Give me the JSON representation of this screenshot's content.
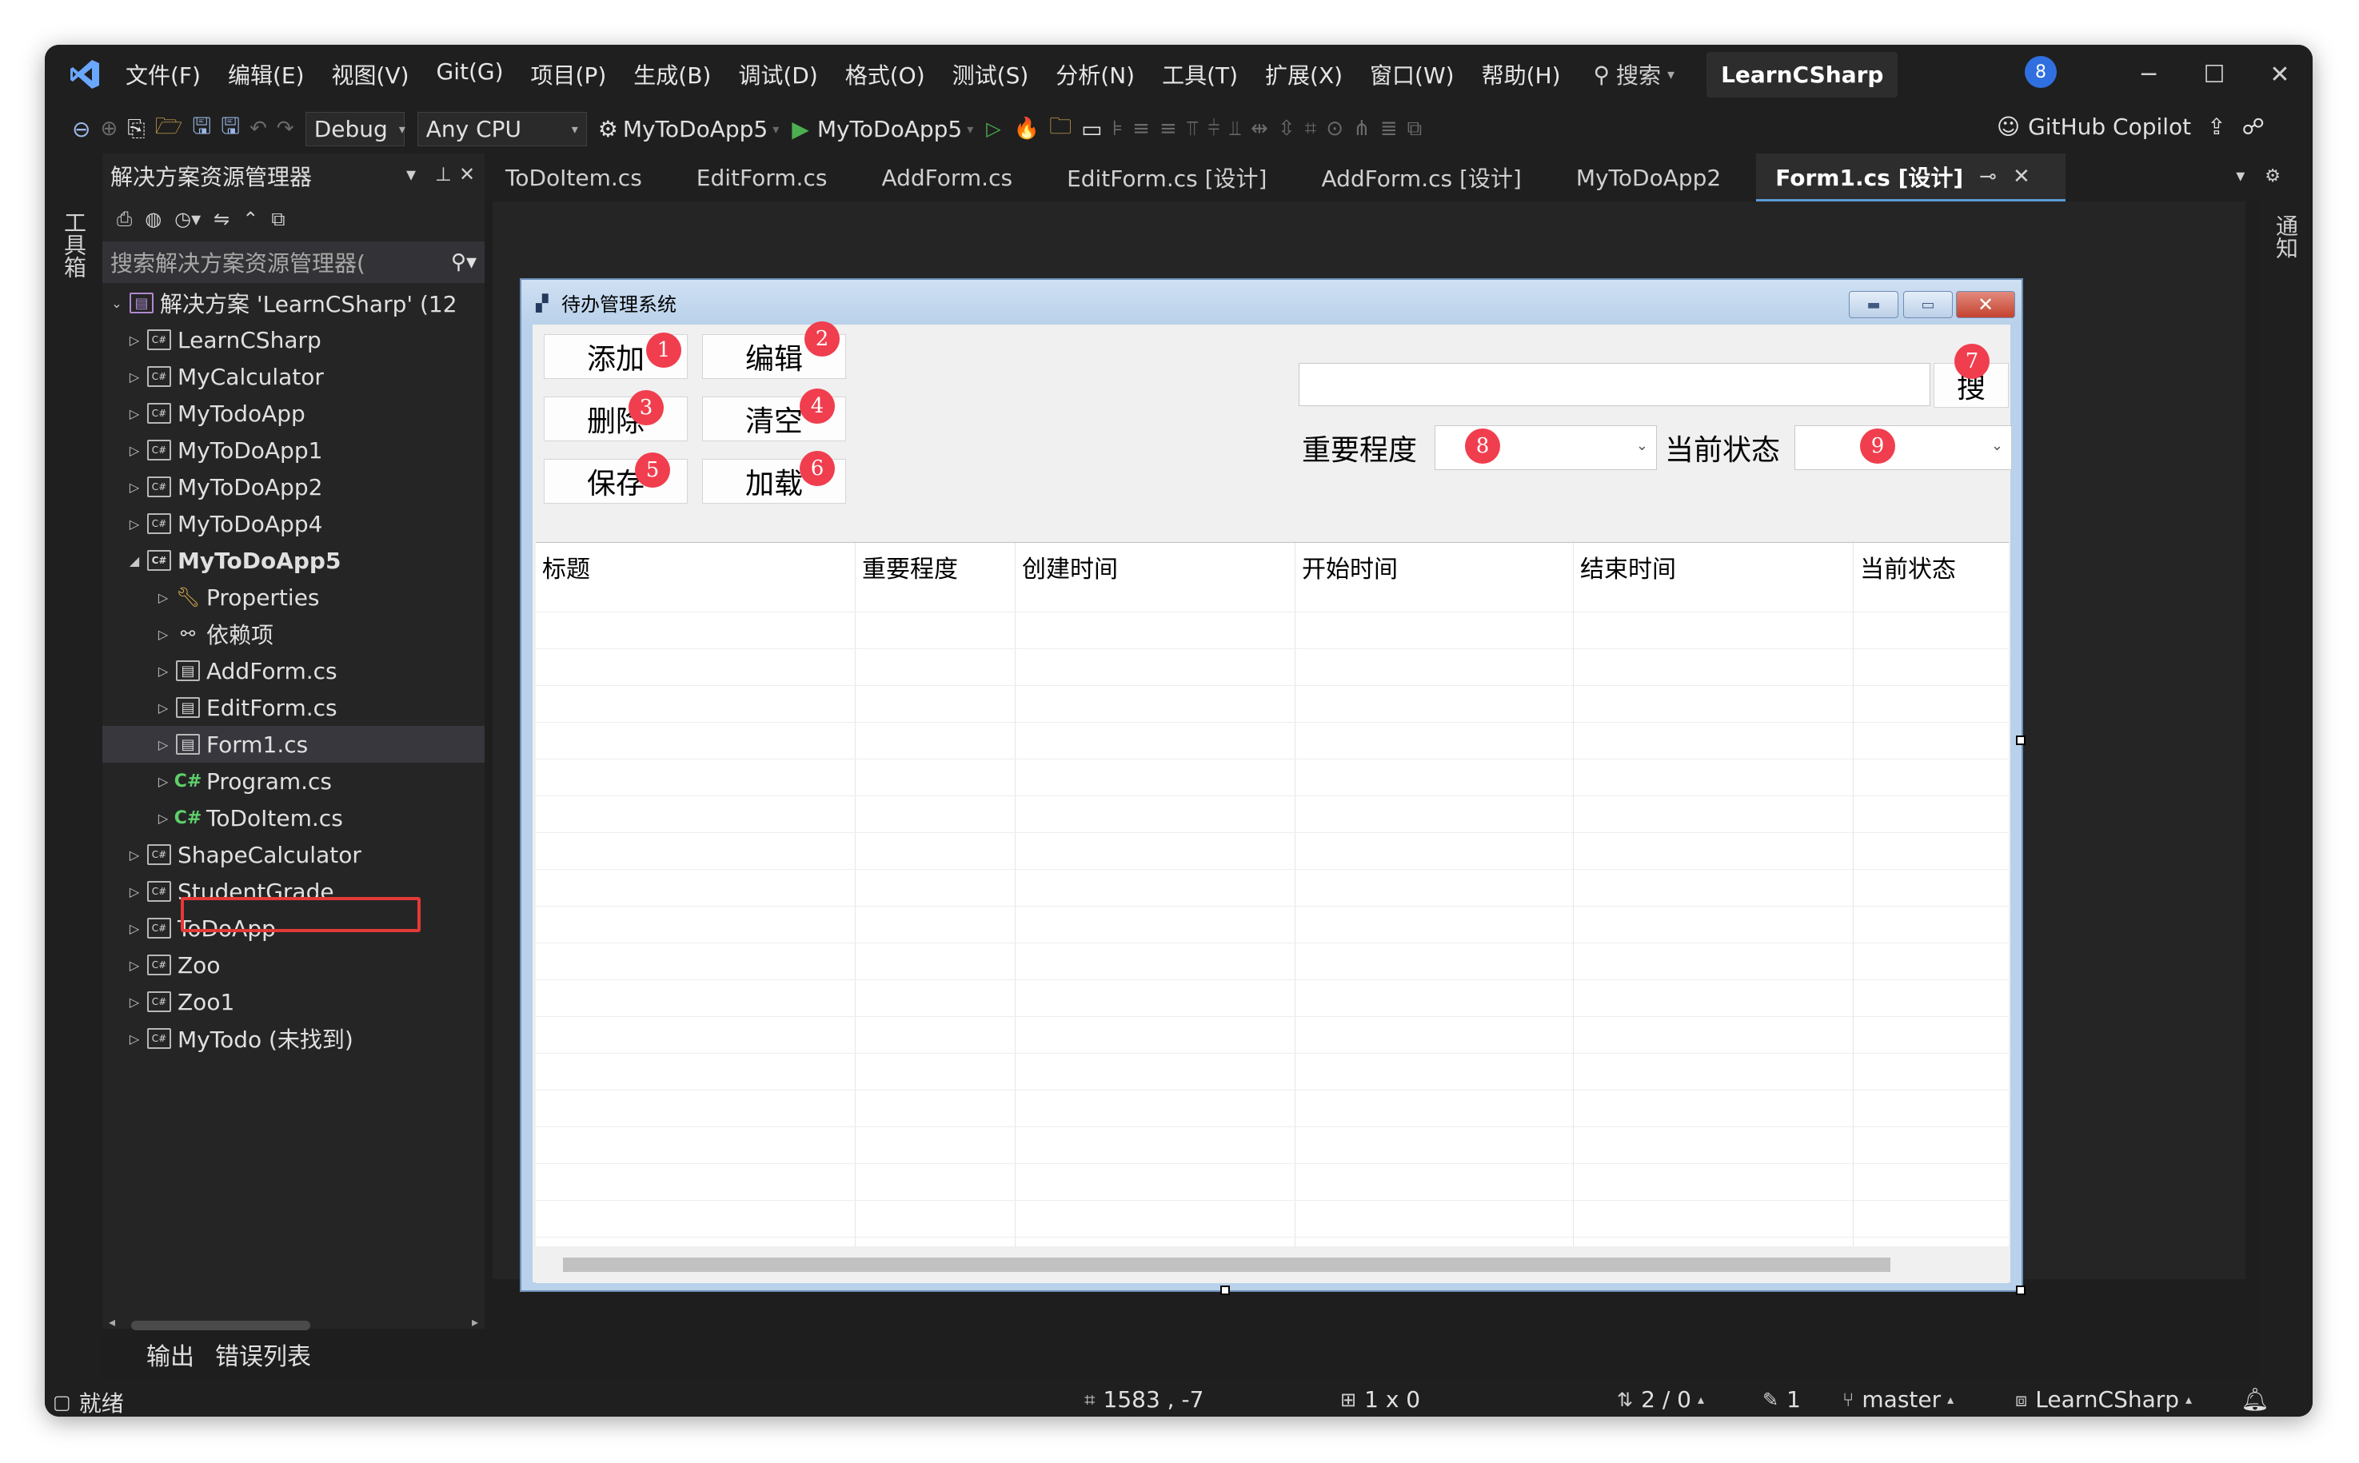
{
  "app": {
    "menu": [
      "文件(F)",
      "编辑(E)",
      "视图(V)",
      "Git(G)",
      "项目(P)",
      "生成(B)",
      "调试(D)",
      "格式(O)",
      "测试(S)",
      "分析(N)",
      "工具(T)",
      "扩展(X)",
      "窗口(W)",
      "帮助(H)"
    ],
    "search_label": "搜索",
    "solution_name": "LearnCSharp",
    "notification_badge": "8"
  },
  "toolbar": {
    "config": "Debug",
    "platform": "Any CPU",
    "startup_project": "MyToDoApp5",
    "run_target": "MyToDoApp5",
    "copilot": "GitHub Copilot"
  },
  "side_strips": {
    "toolbox": "工具箱",
    "notifications": "通知"
  },
  "solution_explorer": {
    "title": "解决方案资源管理器",
    "search_placeholder": "搜索解决方案资源管理器(",
    "solution_root": "解决方案 'LearnCSharp' (12",
    "items": [
      {
        "label": "LearnCSharp",
        "level": 1,
        "icon": "project",
        "expanded": false
      },
      {
        "label": "MyCalculator",
        "level": 1,
        "icon": "project",
        "expanded": false
      },
      {
        "label": "MyTodoApp",
        "level": 1,
        "icon": "project",
        "expanded": false
      },
      {
        "label": "MyToDoApp1",
        "level": 1,
        "icon": "project",
        "expanded": false
      },
      {
        "label": "MyToDoApp2",
        "level": 1,
        "icon": "project",
        "expanded": false
      },
      {
        "label": "MyToDoApp4",
        "level": 1,
        "icon": "project",
        "expanded": false
      },
      {
        "label": "MyToDoApp5",
        "level": 1,
        "icon": "project",
        "expanded": true,
        "bold": true
      },
      {
        "label": "Properties",
        "level": 2,
        "icon": "properties",
        "expanded": false
      },
      {
        "label": "依赖项",
        "level": 2,
        "icon": "dependencies",
        "expanded": false
      },
      {
        "label": "AddForm.cs",
        "level": 2,
        "icon": "form",
        "expanded": false
      },
      {
        "label": "EditForm.cs",
        "level": 2,
        "icon": "form",
        "expanded": false
      },
      {
        "label": "Form1.cs",
        "level": 2,
        "icon": "form",
        "expanded": false,
        "selected": true
      },
      {
        "label": "Program.cs",
        "level": 2,
        "icon": "csharp",
        "expanded": false
      },
      {
        "label": "ToDoItem.cs",
        "level": 2,
        "icon": "csharp",
        "expanded": false
      },
      {
        "label": "ShapeCalculator",
        "level": 1,
        "icon": "project",
        "expanded": false
      },
      {
        "label": "StudentGrade",
        "level": 1,
        "icon": "project",
        "expanded": false
      },
      {
        "label": "ToDoApp",
        "level": 1,
        "icon": "project",
        "expanded": false
      },
      {
        "label": "Zoo",
        "level": 1,
        "icon": "project",
        "expanded": false
      },
      {
        "label": "Zoo1",
        "level": 1,
        "icon": "project",
        "expanded": false
      },
      {
        "label": "MyTodo (未找到)",
        "level": 1,
        "icon": "project-missing",
        "expanded": false
      }
    ]
  },
  "doc_tabs": [
    {
      "label": "ToDoItem.cs",
      "active": false
    },
    {
      "label": "EditForm.cs",
      "active": false
    },
    {
      "label": "AddForm.cs",
      "active": false
    },
    {
      "label": "EditForm.cs [设计]",
      "active": false
    },
    {
      "label": "AddForm.cs [设计]",
      "active": false
    },
    {
      "label": "MyToDoApp2",
      "active": false
    },
    {
      "label": "Form1.cs [设计]",
      "active": true
    }
  ],
  "form": {
    "title": "待办管理系统",
    "buttons": [
      {
        "label": "添加",
        "num": "1"
      },
      {
        "label": "编辑",
        "num": "2"
      },
      {
        "label": "删除",
        "num": "3"
      },
      {
        "label": "清空",
        "num": "4"
      },
      {
        "label": "保存",
        "num": "5"
      },
      {
        "label": "加载",
        "num": "6"
      }
    ],
    "search_button": "搜",
    "search_num": "7",
    "priority_label": "重要程度",
    "priority_num": "8",
    "status_label": "当前状态",
    "status_num": "9",
    "grid_columns": [
      "标题",
      "重要程度",
      "创建时间",
      "开始时间",
      "结束时间",
      "当前状态"
    ]
  },
  "bottom_tabs": [
    "输出",
    "错误列表"
  ],
  "statusbar": {
    "ready": "就绪",
    "position": "1583 , -7",
    "size": "1 x 0",
    "changes": "2 / 0",
    "edits": "1",
    "branch": "master",
    "repo": "LearnCSharp"
  },
  "colors": {
    "accent": "#5a9bd5",
    "highlight_box": "#e53935",
    "number_badge": "#f03e4e",
    "run_green": "#4caf50"
  }
}
